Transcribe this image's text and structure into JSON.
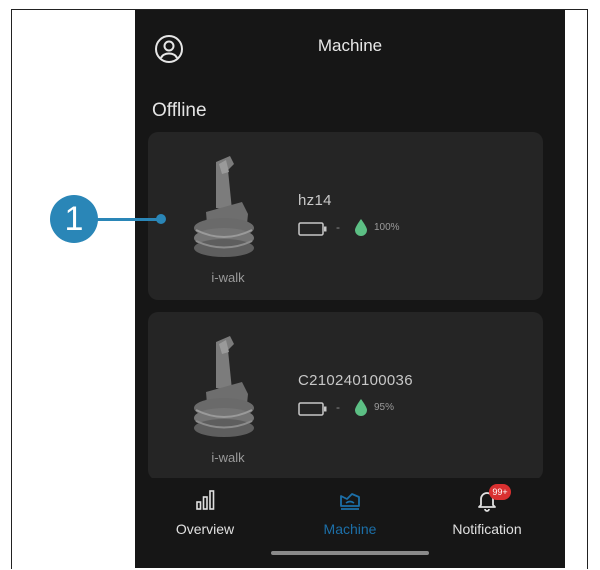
{
  "header": {
    "title": "Machine",
    "profile_icon": "user-circle-icon"
  },
  "section": {
    "title": "Offline"
  },
  "machines": [
    {
      "name": "hz14",
      "model": "i-walk",
      "battery": "-",
      "water_percent": "100%",
      "battery_icon": "battery-icon",
      "water_icon": "water-drop-icon"
    },
    {
      "name": "C210240100036",
      "model": "i-walk",
      "battery": "-",
      "water_percent": "95%",
      "battery_icon": "battery-icon",
      "water_icon": "water-drop-icon"
    }
  ],
  "bottom_nav": {
    "items": [
      {
        "label": "Overview",
        "icon": "bar-chart-icon"
      },
      {
        "label": "Machine",
        "icon": "machine-icon",
        "active": true
      },
      {
        "label": "Notification",
        "icon": "bell-icon",
        "badge": "99+"
      }
    ]
  },
  "callout": {
    "number": "1"
  },
  "colors": {
    "background": "#161616",
    "card": "#252525",
    "accent": "#1c6fa8",
    "water": "#5cbf84",
    "callout": "#2a86b7",
    "badge": "#d93030"
  }
}
